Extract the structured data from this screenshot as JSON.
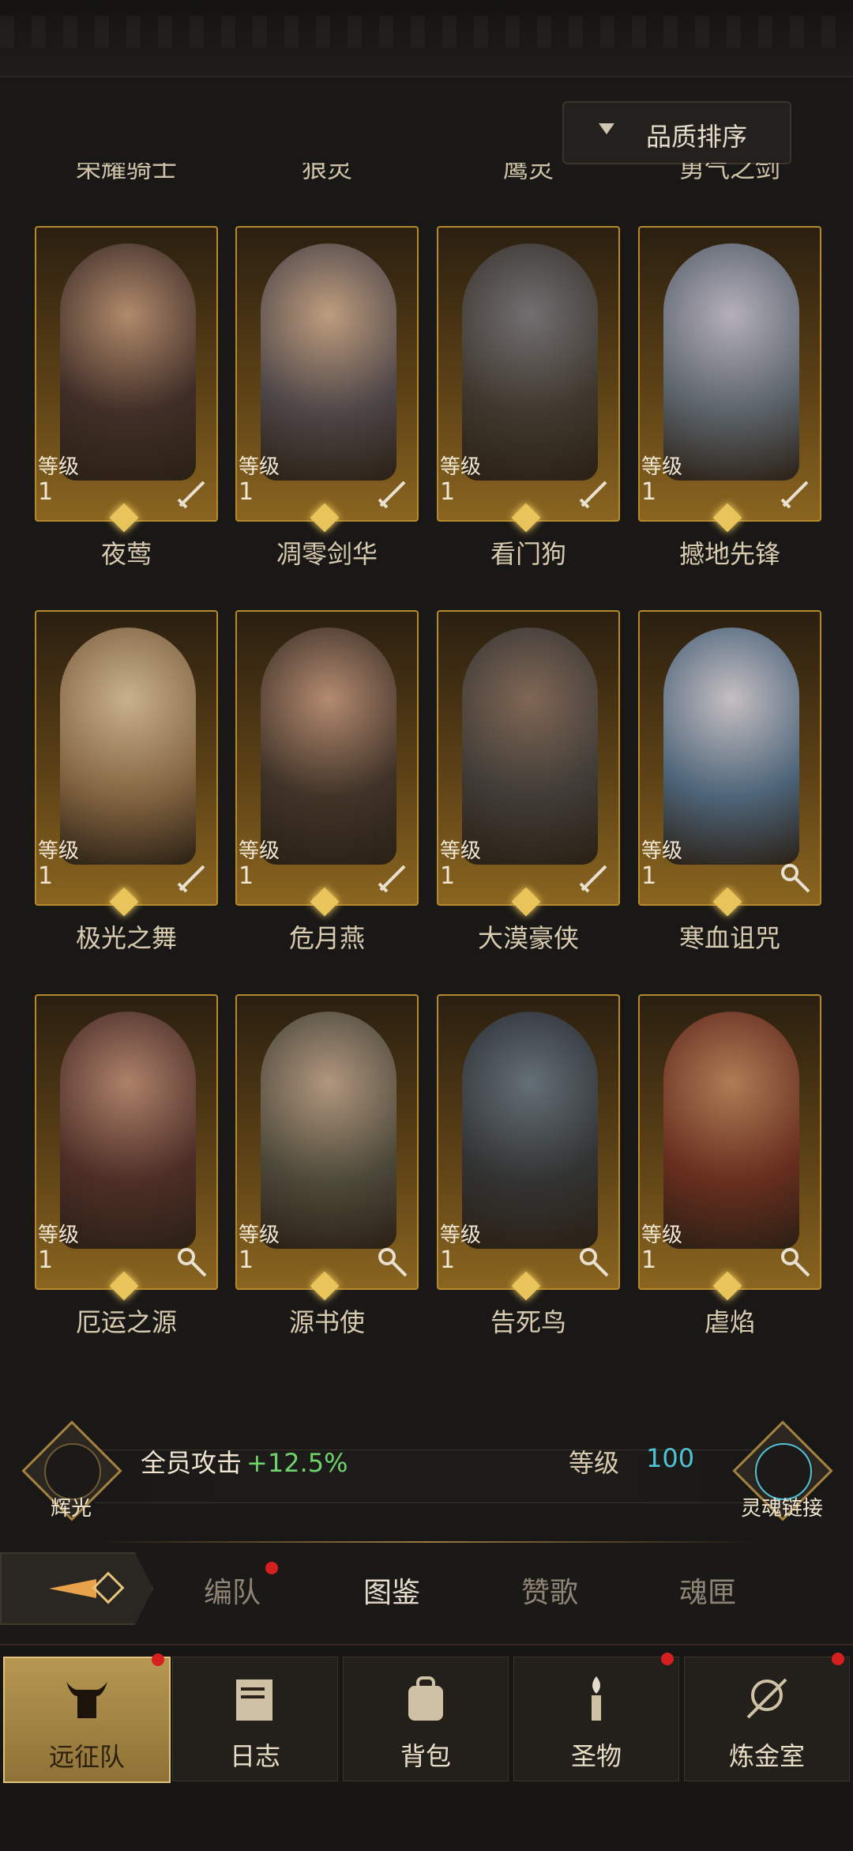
{
  "sort": {
    "label": "品质排序"
  },
  "cut_names": [
    "荣耀骑士",
    "狼灵",
    "鹰灵",
    "勇气之剑"
  ],
  "level_label": "等级",
  "heroes": [
    {
      "name": "夜莺",
      "level": "1",
      "class": "sword"
    },
    {
      "name": "凋零剑华",
      "level": "1",
      "class": "sword"
    },
    {
      "name": "看门狗",
      "level": "1",
      "class": "sword"
    },
    {
      "name": "撼地先锋",
      "level": "1",
      "class": "sword"
    },
    {
      "name": "极光之舞",
      "level": "1",
      "class": "sword"
    },
    {
      "name": "危月燕",
      "level": "1",
      "class": "sword"
    },
    {
      "name": "大漠豪侠",
      "level": "1",
      "class": "sword"
    },
    {
      "name": "寒血诅咒",
      "level": "1",
      "class": "staff"
    },
    {
      "name": "厄运之源",
      "level": "1",
      "class": "staff"
    },
    {
      "name": "源书使",
      "level": "1",
      "class": "staff"
    },
    {
      "name": "告死鸟",
      "level": "1",
      "class": "staff"
    },
    {
      "name": "虐焰",
      "level": "1",
      "class": "staff"
    }
  ],
  "stats": {
    "left_emblem": "辉光",
    "attack_label": "全员攻击",
    "attack_value": "+12.5%",
    "level_label": "等级",
    "level_value": "100",
    "right_emblem": "灵魂链接"
  },
  "tabs": [
    {
      "label": "编队",
      "badge": true
    },
    {
      "label": "图鉴",
      "badge": false,
      "active": true
    },
    {
      "label": "赞歌",
      "badge": false
    },
    {
      "label": "魂匣",
      "badge": false
    }
  ],
  "nav": [
    {
      "label": "远征队",
      "icon": "helmet-icon",
      "active": true,
      "badge": true
    },
    {
      "label": "日志",
      "icon": "scroll-icon",
      "active": false,
      "badge": false
    },
    {
      "label": "背包",
      "icon": "bag-icon",
      "active": false,
      "badge": false
    },
    {
      "label": "圣物",
      "icon": "torch-icon",
      "active": false,
      "badge": true
    },
    {
      "label": "炼金室",
      "icon": "alchemy-icon",
      "active": false,
      "badge": true
    }
  ],
  "colors": {
    "gold": "#b48a2c",
    "accent_cyan": "#4ec3d6",
    "positive": "#6fd46b",
    "badge": "#d61f1f"
  }
}
